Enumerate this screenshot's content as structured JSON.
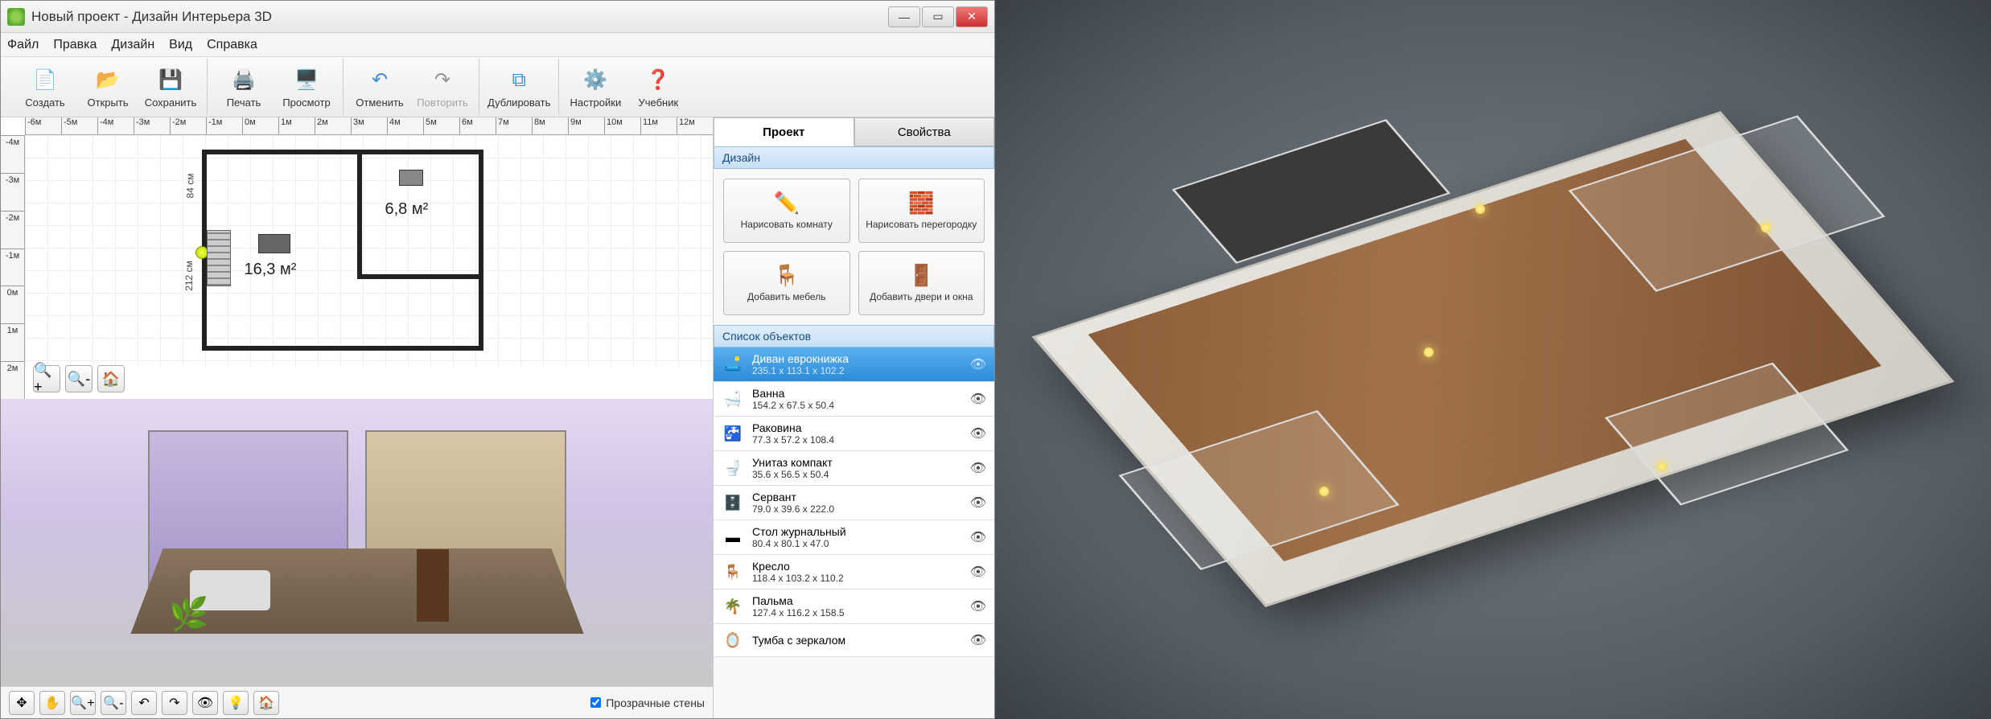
{
  "window": {
    "title": "Новый проект - Дизайн Интерьера 3D"
  },
  "menu": {
    "items": [
      "Файл",
      "Правка",
      "Дизайн",
      "Вид",
      "Справка"
    ]
  },
  "toolbar": {
    "create": "Создать",
    "open": "Открыть",
    "save": "Сохранить",
    "print": "Печать",
    "preview": "Просмотр",
    "undo": "Отменить",
    "redo": "Повторить",
    "duplicate": "Дублировать",
    "settings": "Настройки",
    "tutorial": "Учебник"
  },
  "ruler": {
    "h": [
      "-6м",
      "-5м",
      "-4м",
      "-3м",
      "-2м",
      "-1м",
      "0м",
      "1м",
      "2м",
      "3м",
      "4м",
      "5м",
      "6м",
      "7м",
      "8м",
      "9м",
      "10м",
      "11м",
      "12м"
    ],
    "v": [
      "-4м",
      "-3м",
      "-2м",
      "-1м",
      "0м",
      "1м",
      "2м"
    ]
  },
  "plan": {
    "room1_area": "6,8 м²",
    "room2_area": "16,3 м²",
    "dim1": "84 см",
    "dim2": "212 см"
  },
  "sidepanel": {
    "tabs": {
      "project": "Проект",
      "properties": "Свойства"
    },
    "section_design": "Дизайн",
    "section_objects": "Список объектов",
    "buttons": {
      "draw_room": "Нарисовать комнату",
      "draw_wall": "Нарисовать перегородку",
      "add_furniture": "Добавить мебель",
      "add_doors": "Добавить двери и окна"
    }
  },
  "objects": [
    {
      "name": "Диван еврокнижка",
      "dims": "235.1 x 113.1 x 102.2",
      "icon": "🛋️",
      "selected": true
    },
    {
      "name": "Ванна",
      "dims": "154.2 x 67.5 x 50.4",
      "icon": "🛁",
      "selected": false
    },
    {
      "name": "Раковина",
      "dims": "77.3 x 57.2 x 108.4",
      "icon": "🚰",
      "selected": false
    },
    {
      "name": "Унитаз компакт",
      "dims": "35.6 x 56.5 x 50.4",
      "icon": "🚽",
      "selected": false
    },
    {
      "name": "Сервант",
      "dims": "79.0 x 39.6 x 222.0",
      "icon": "🗄️",
      "selected": false
    },
    {
      "name": "Стол журнальный",
      "dims": "80.4 x 80.1 x 47.0",
      "icon": "▬",
      "selected": false
    },
    {
      "name": "Кресло",
      "dims": "118.4 x 103.2 x 110.2",
      "icon": "🪑",
      "selected": false
    },
    {
      "name": "Пальма",
      "dims": "127.4 x 116.2 x 158.5",
      "icon": "🌴",
      "selected": false
    },
    {
      "name": "Тумба с зеркалом",
      "dims": "",
      "icon": "🪞",
      "selected": false
    }
  ],
  "bottom": {
    "transparent_walls": "Прозрачные стены"
  }
}
